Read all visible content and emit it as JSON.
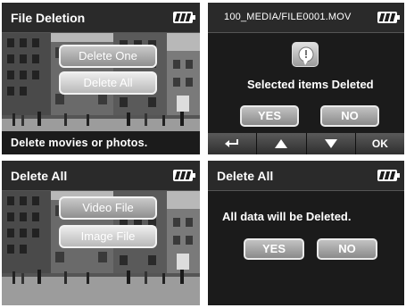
{
  "panel1": {
    "title": "File Deletion",
    "battery_icon": "battery-full-icon",
    "buttons": [
      "Delete One",
      "Delete All"
    ],
    "selected_index": 1,
    "footer": "Delete movies or photos."
  },
  "panel2": {
    "path": "100_MEDIA/FILE0001.MOV",
    "battery_icon": "battery-full-icon",
    "info_icon": "info-bubble-icon",
    "message": "Selected items Deleted",
    "yes_label": "YES",
    "no_label": "NO",
    "nav": [
      {
        "icon": "return-arrow-icon"
      },
      {
        "icon": "up-triangle-icon"
      },
      {
        "icon": "down-triangle-icon"
      },
      {
        "label": "OK"
      }
    ]
  },
  "panel3": {
    "title": "Delete All",
    "battery_icon": "battery-full-icon",
    "buttons": [
      "Video File",
      "Image File"
    ],
    "selected_index": 1
  },
  "panel4": {
    "title": "Delete All",
    "battery_icon": "battery-full-icon",
    "message": "All data will be Deleted.",
    "yes_label": "YES",
    "no_label": "NO"
  }
}
